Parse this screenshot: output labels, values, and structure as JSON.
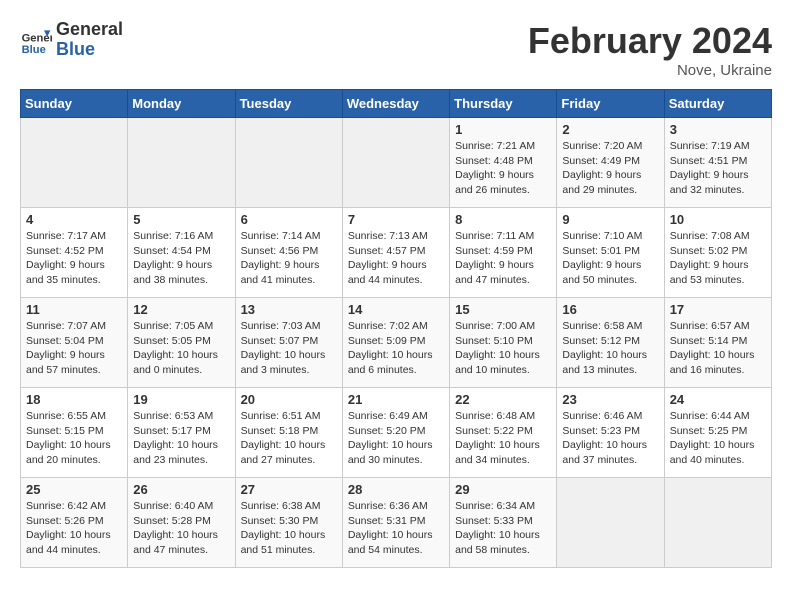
{
  "header": {
    "logo_line1": "General",
    "logo_line2": "Blue",
    "month_year": "February 2024",
    "location": "Nove, Ukraine"
  },
  "weekdays": [
    "Sunday",
    "Monday",
    "Tuesday",
    "Wednesday",
    "Thursday",
    "Friday",
    "Saturday"
  ],
  "weeks": [
    [
      {
        "day": "",
        "info": ""
      },
      {
        "day": "",
        "info": ""
      },
      {
        "day": "",
        "info": ""
      },
      {
        "day": "",
        "info": ""
      },
      {
        "day": "1",
        "info": "Sunrise: 7:21 AM\nSunset: 4:48 PM\nDaylight: 9 hours\nand 26 minutes."
      },
      {
        "day": "2",
        "info": "Sunrise: 7:20 AM\nSunset: 4:49 PM\nDaylight: 9 hours\nand 29 minutes."
      },
      {
        "day": "3",
        "info": "Sunrise: 7:19 AM\nSunset: 4:51 PM\nDaylight: 9 hours\nand 32 minutes."
      }
    ],
    [
      {
        "day": "4",
        "info": "Sunrise: 7:17 AM\nSunset: 4:52 PM\nDaylight: 9 hours\nand 35 minutes."
      },
      {
        "day": "5",
        "info": "Sunrise: 7:16 AM\nSunset: 4:54 PM\nDaylight: 9 hours\nand 38 minutes."
      },
      {
        "day": "6",
        "info": "Sunrise: 7:14 AM\nSunset: 4:56 PM\nDaylight: 9 hours\nand 41 minutes."
      },
      {
        "day": "7",
        "info": "Sunrise: 7:13 AM\nSunset: 4:57 PM\nDaylight: 9 hours\nand 44 minutes."
      },
      {
        "day": "8",
        "info": "Sunrise: 7:11 AM\nSunset: 4:59 PM\nDaylight: 9 hours\nand 47 minutes."
      },
      {
        "day": "9",
        "info": "Sunrise: 7:10 AM\nSunset: 5:01 PM\nDaylight: 9 hours\nand 50 minutes."
      },
      {
        "day": "10",
        "info": "Sunrise: 7:08 AM\nSunset: 5:02 PM\nDaylight: 9 hours\nand 53 minutes."
      }
    ],
    [
      {
        "day": "11",
        "info": "Sunrise: 7:07 AM\nSunset: 5:04 PM\nDaylight: 9 hours\nand 57 minutes."
      },
      {
        "day": "12",
        "info": "Sunrise: 7:05 AM\nSunset: 5:05 PM\nDaylight: 10 hours\nand 0 minutes."
      },
      {
        "day": "13",
        "info": "Sunrise: 7:03 AM\nSunset: 5:07 PM\nDaylight: 10 hours\nand 3 minutes."
      },
      {
        "day": "14",
        "info": "Sunrise: 7:02 AM\nSunset: 5:09 PM\nDaylight: 10 hours\nand 6 minutes."
      },
      {
        "day": "15",
        "info": "Sunrise: 7:00 AM\nSunset: 5:10 PM\nDaylight: 10 hours\nand 10 minutes."
      },
      {
        "day": "16",
        "info": "Sunrise: 6:58 AM\nSunset: 5:12 PM\nDaylight: 10 hours\nand 13 minutes."
      },
      {
        "day": "17",
        "info": "Sunrise: 6:57 AM\nSunset: 5:14 PM\nDaylight: 10 hours\nand 16 minutes."
      }
    ],
    [
      {
        "day": "18",
        "info": "Sunrise: 6:55 AM\nSunset: 5:15 PM\nDaylight: 10 hours\nand 20 minutes."
      },
      {
        "day": "19",
        "info": "Sunrise: 6:53 AM\nSunset: 5:17 PM\nDaylight: 10 hours\nand 23 minutes."
      },
      {
        "day": "20",
        "info": "Sunrise: 6:51 AM\nSunset: 5:18 PM\nDaylight: 10 hours\nand 27 minutes."
      },
      {
        "day": "21",
        "info": "Sunrise: 6:49 AM\nSunset: 5:20 PM\nDaylight: 10 hours\nand 30 minutes."
      },
      {
        "day": "22",
        "info": "Sunrise: 6:48 AM\nSunset: 5:22 PM\nDaylight: 10 hours\nand 34 minutes."
      },
      {
        "day": "23",
        "info": "Sunrise: 6:46 AM\nSunset: 5:23 PM\nDaylight: 10 hours\nand 37 minutes."
      },
      {
        "day": "24",
        "info": "Sunrise: 6:44 AM\nSunset: 5:25 PM\nDaylight: 10 hours\nand 40 minutes."
      }
    ],
    [
      {
        "day": "25",
        "info": "Sunrise: 6:42 AM\nSunset: 5:26 PM\nDaylight: 10 hours\nand 44 minutes."
      },
      {
        "day": "26",
        "info": "Sunrise: 6:40 AM\nSunset: 5:28 PM\nDaylight: 10 hours\nand 47 minutes."
      },
      {
        "day": "27",
        "info": "Sunrise: 6:38 AM\nSunset: 5:30 PM\nDaylight: 10 hours\nand 51 minutes."
      },
      {
        "day": "28",
        "info": "Sunrise: 6:36 AM\nSunset: 5:31 PM\nDaylight: 10 hours\nand 54 minutes."
      },
      {
        "day": "29",
        "info": "Sunrise: 6:34 AM\nSunset: 5:33 PM\nDaylight: 10 hours\nand 58 minutes."
      },
      {
        "day": "",
        "info": ""
      },
      {
        "day": "",
        "info": ""
      }
    ]
  ]
}
